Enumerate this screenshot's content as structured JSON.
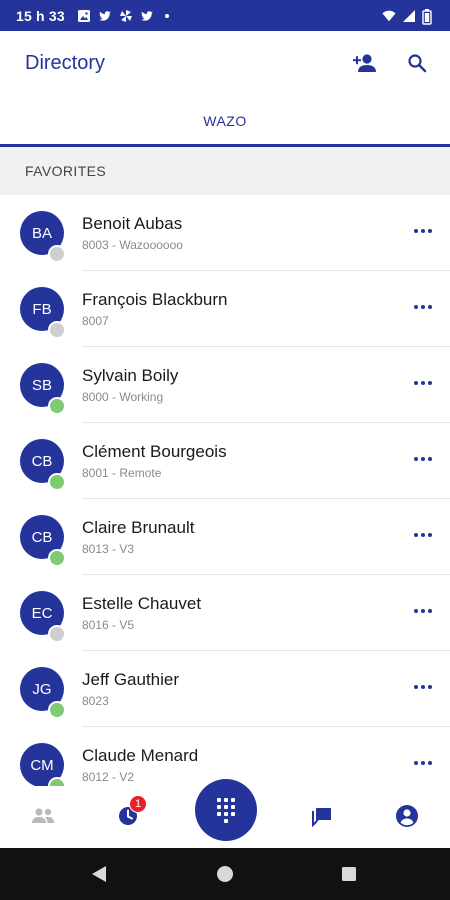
{
  "status_bar": {
    "time": "15 h 33",
    "left_icons": [
      "gallery-icon",
      "twitter-icon",
      "pinwheel-icon",
      "twitter-icon",
      "dot-icon"
    ],
    "right_icons": [
      "wifi-icon",
      "signal-icon",
      "battery-icon"
    ]
  },
  "app_bar": {
    "title": "Directory",
    "actions": [
      "add-contact-icon",
      "search-icon"
    ]
  },
  "tabs": [
    {
      "label": "WAZO",
      "active": true
    }
  ],
  "section": {
    "title": "FAVORITES"
  },
  "contacts": [
    {
      "initials": "BA",
      "name": "Benoit Aubas",
      "subtitle": "8003 - Wazoooooo",
      "status": "offline"
    },
    {
      "initials": "FB",
      "name": "François Blackburn",
      "subtitle": "8007",
      "status": "offline"
    },
    {
      "initials": "SB",
      "name": "Sylvain Boily",
      "subtitle": "8000 - Working",
      "status": "available"
    },
    {
      "initials": "CB",
      "name": "Clément Bourgeois",
      "subtitle": "8001 - Remote",
      "status": "available"
    },
    {
      "initials": "CB",
      "name": "Claire Brunault",
      "subtitle": "8013 - V3",
      "status": "available"
    },
    {
      "initials": "EC",
      "name": "Estelle Chauvet",
      "subtitle": "8016 - V5",
      "status": "offline"
    },
    {
      "initials": "JG",
      "name": "Jeff Gauthier",
      "subtitle": "8023",
      "status": "available"
    },
    {
      "initials": "CM",
      "name": "Claude Menard",
      "subtitle": "8012 - V2",
      "status": "available"
    }
  ],
  "bottom_nav": {
    "items": [
      "contacts-icon",
      "call-history-icon",
      "dialpad-icon",
      "messages-icon",
      "account-icon"
    ],
    "history_badge": "1"
  },
  "system_nav": [
    "back-icon",
    "home-icon",
    "recents-icon"
  ],
  "colors": {
    "primary": "#24349b",
    "available": "#7fcb72",
    "offline": "#cfcfcf",
    "badge": "#e8202a"
  }
}
